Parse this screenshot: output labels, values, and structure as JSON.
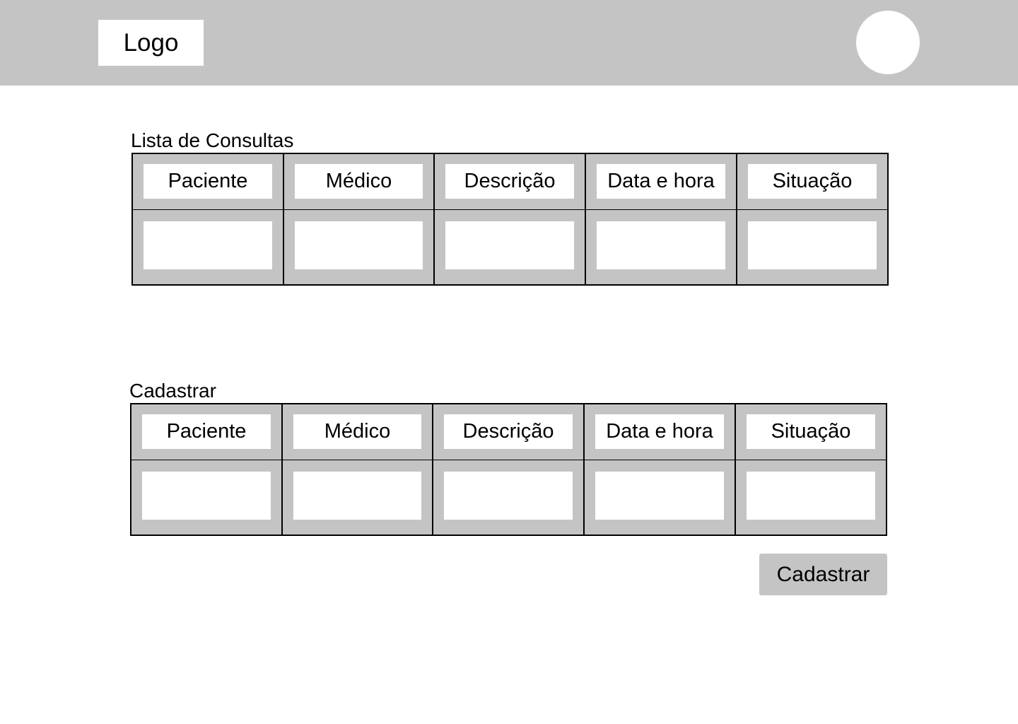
{
  "header": {
    "logo_text": "Logo",
    "avatar_icon": "user-avatar-icon"
  },
  "list_section": {
    "title": "Lista de Consultas",
    "columns": [
      "Paciente",
      "Médico",
      "Descrição",
      "Data e hora",
      "Situação"
    ],
    "rows": [
      [
        "",
        "",
        "",
        "",
        ""
      ]
    ]
  },
  "register_section": {
    "title": "Cadastrar",
    "columns": [
      "Paciente",
      "Médico",
      "Descrição",
      "Data e hora",
      "Situação"
    ],
    "values": [
      "",
      "",
      "",
      "",
      ""
    ],
    "submit_label": "Cadastrar"
  },
  "colors": {
    "bar_gray": "#c4c4c4",
    "background": "#ffffff",
    "border": "#000000"
  }
}
